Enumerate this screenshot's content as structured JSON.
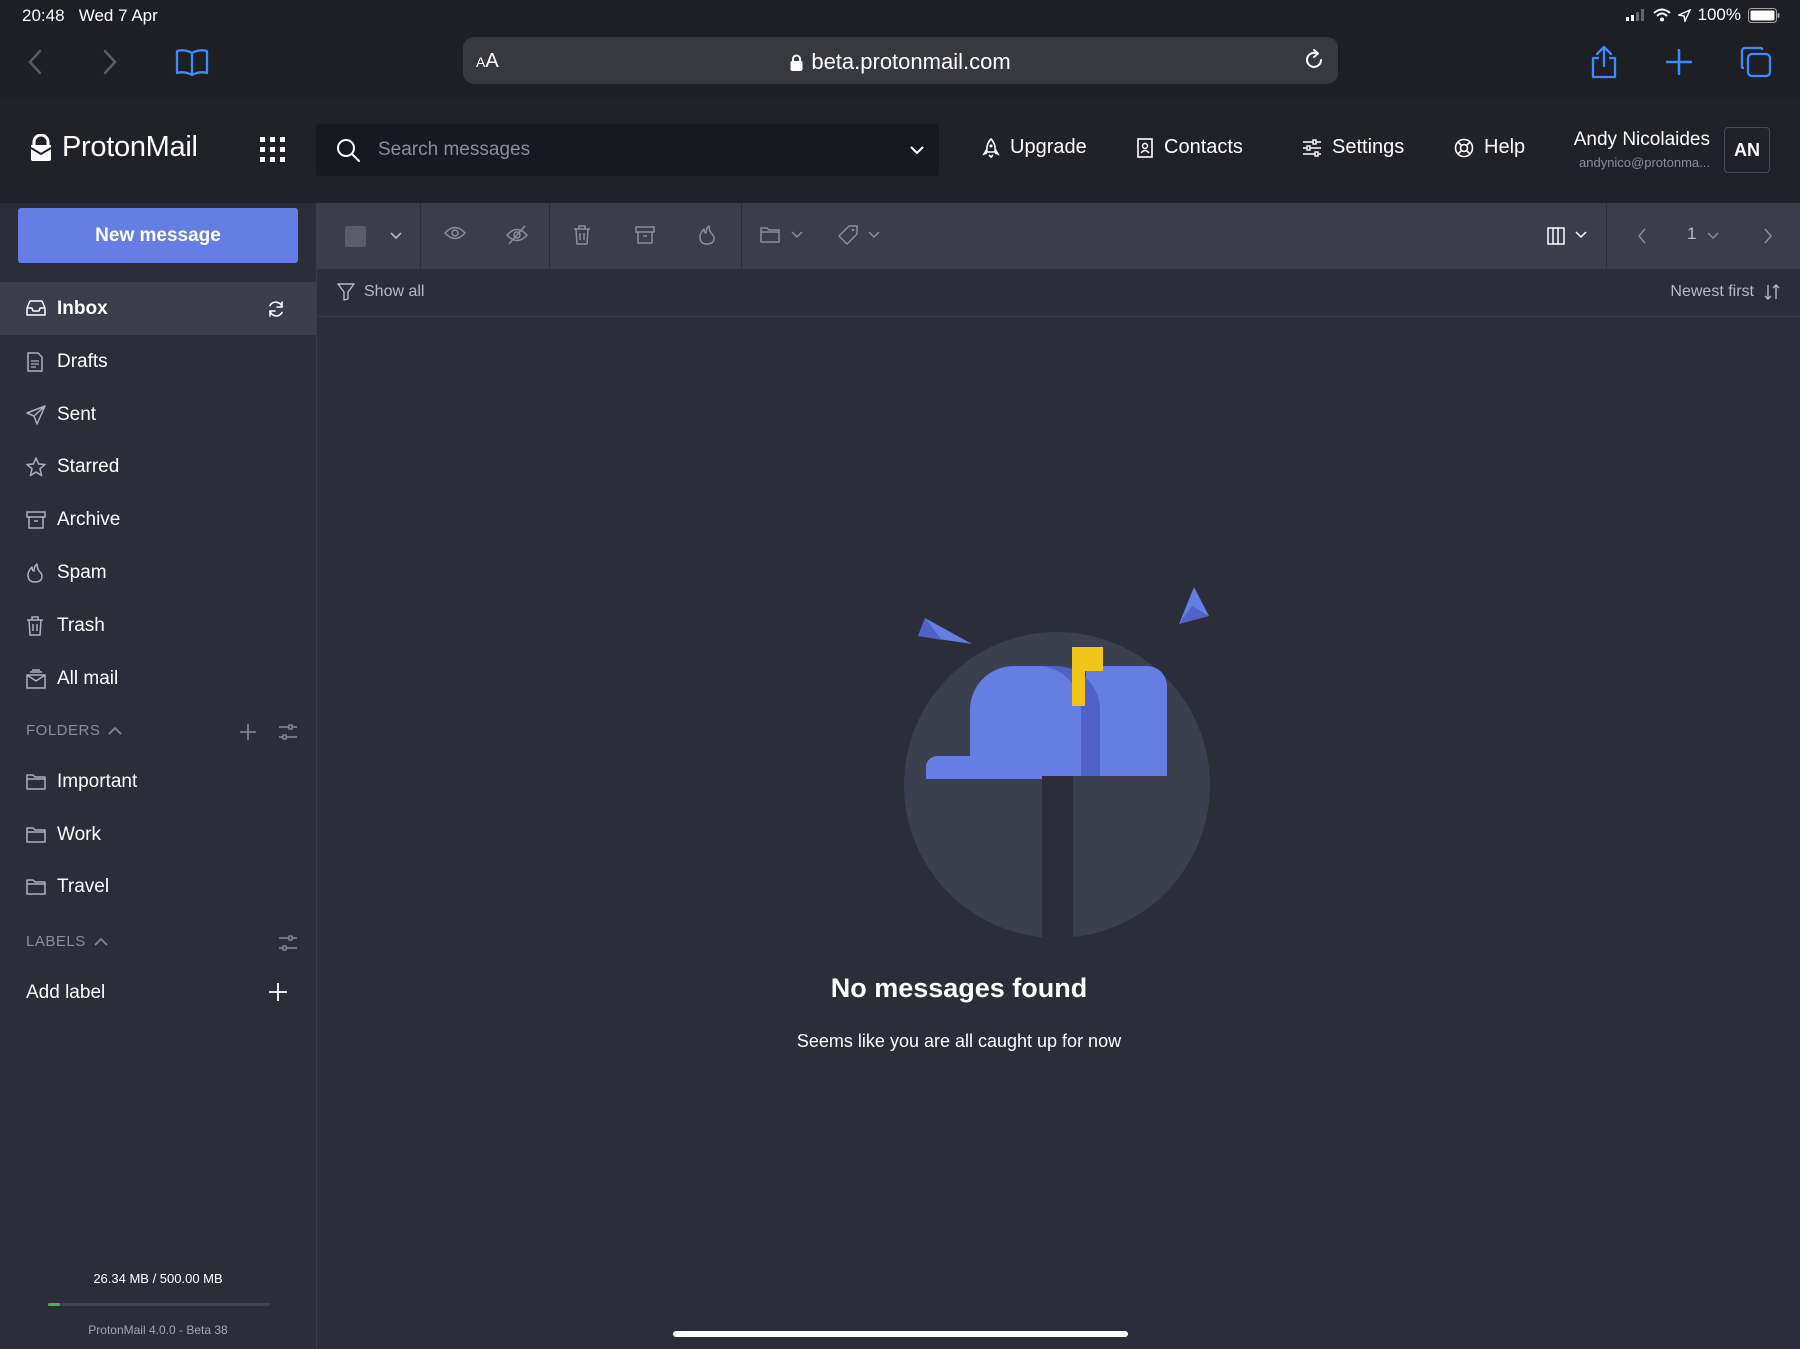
{
  "status": {
    "time": "20:48",
    "date": "Wed 7 Apr",
    "battery": "100%"
  },
  "browser": {
    "aa_label": "AA",
    "url": "beta.protonmail.com"
  },
  "header": {
    "logo": "ProtonMail",
    "search_placeholder": "Search messages",
    "nav": {
      "upgrade": "Upgrade",
      "contacts": "Contacts",
      "settings": "Settings",
      "help": "Help"
    },
    "user": {
      "name": "Andy Nicolaides",
      "email": "andynico@protonma...",
      "initials": "AN"
    }
  },
  "sidebar": {
    "new_message": "New message",
    "items": [
      {
        "label": "Inbox"
      },
      {
        "label": "Drafts"
      },
      {
        "label": "Sent"
      },
      {
        "label": "Starred"
      },
      {
        "label": "Archive"
      },
      {
        "label": "Spam"
      },
      {
        "label": "Trash"
      },
      {
        "label": "All mail"
      }
    ],
    "folders_heading": "FOLDERS",
    "folders": [
      {
        "label": "Important"
      },
      {
        "label": "Work"
      },
      {
        "label": "Travel"
      }
    ],
    "labels_heading": "LABELS",
    "add_label": "Add label",
    "storage": {
      "text": "26.34 MB / 500.00 MB",
      "used_fraction": 0.053
    },
    "version": "ProtonMail 4.0.0 - Beta 38"
  },
  "toolbar": {
    "page": "1"
  },
  "filter": {
    "show_all": "Show all",
    "sort": "Newest first"
  },
  "empty": {
    "title": "No messages found",
    "subtitle": "Seems like you are all caught up for now"
  },
  "colors": {
    "accent": "#657ee4",
    "flag": "#f0c419",
    "storage": "#4bb04b"
  }
}
